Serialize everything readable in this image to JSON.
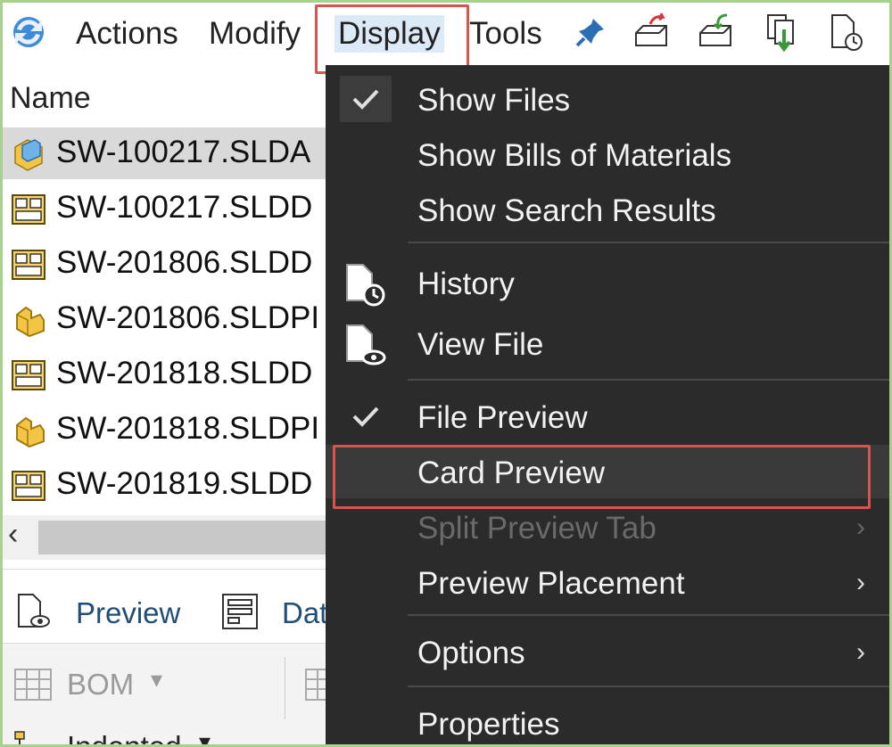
{
  "menubar": {
    "items": [
      "Actions",
      "Modify",
      "Display",
      "Tools"
    ],
    "icons": [
      "refresh-icon",
      "pin-icon",
      "export-box-icon",
      "import-box-icon",
      "copy-down-icon",
      "history-doc-icon"
    ]
  },
  "list": {
    "header": "Name",
    "rows": [
      {
        "name": "SW-100217.SLDA",
        "icon": "assembly-icon",
        "selected": true
      },
      {
        "name": "SW-100217.SLDD",
        "icon": "drawing-icon",
        "selected": false
      },
      {
        "name": "SW-201806.SLDD",
        "icon": "drawing-icon",
        "selected": false
      },
      {
        "name": "SW-201806.SLDPI",
        "icon": "part-icon",
        "selected": false
      },
      {
        "name": "SW-201818.SLDD",
        "icon": "drawing-icon",
        "selected": false
      },
      {
        "name": "SW-201818.SLDPI",
        "icon": "part-icon",
        "selected": false
      },
      {
        "name": "SW-201819.SLDD",
        "icon": "drawing-icon",
        "selected": false
      }
    ]
  },
  "bottom": {
    "tabs": [
      "Preview",
      "Dat"
    ],
    "toolbar": {
      "bom": "BOM",
      "indented": "Indented"
    }
  },
  "menu": {
    "show_files": "Show Files",
    "show_bom": "Show Bills of Materials",
    "show_search": "Show Search Results",
    "history": "History",
    "view_file": "View File",
    "file_preview": "File Preview",
    "card_preview": "Card Preview",
    "split_preview": "Split Preview Tab",
    "preview_placement": "Preview Placement",
    "options": "Options",
    "properties": "Properties"
  },
  "colors": {
    "highlight": "#d9534f",
    "menu_bg": "#2b2b2b",
    "frame": "#a9d18e"
  }
}
